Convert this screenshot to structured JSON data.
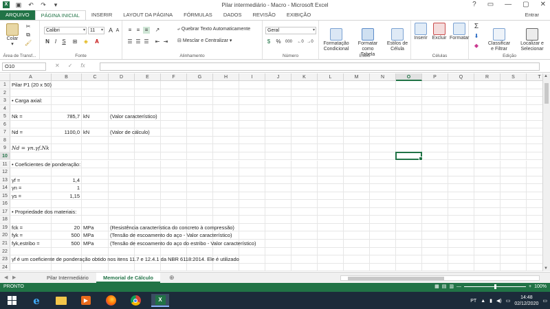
{
  "window": {
    "title": "Pilar intermediário - Macro - Microsoft Excel",
    "controls": [
      "?",
      "▭",
      "—",
      "▢",
      "✕"
    ]
  },
  "ribbon_tabs": [
    "ARQUIVO",
    "PÁGINA INICIAL",
    "INSERIR",
    "LAYOUT DA PÁGINA",
    "FÓRMULAS",
    "DADOS",
    "REVISÃO",
    "EXIBIÇÃO"
  ],
  "user": "Entrar",
  "ribbon": {
    "clipboard": {
      "paste_label": "Colar",
      "group_label": "Área de Transf..."
    },
    "font": {
      "font_name": "Calibri",
      "font_size": "11",
      "group_label": "Fonte",
      "bold": "N",
      "italic": "I",
      "underline": "S"
    },
    "alignment": {
      "wrap_text": "Quebrar Texto Automaticamente",
      "merge_center": "Mesclar e Centralizar",
      "group_label": "Alinhamento"
    },
    "number": {
      "format": "Geral",
      "group_label": "Número",
      "percent": "%",
      "thousands": "000"
    },
    "styles": {
      "conditional": "Formatação\nCondicional",
      "format_table": "Formatar como\nTabela",
      "cell_styles": "Estilos de\nCélula",
      "group_label": "Estilo"
    },
    "cells": {
      "insert": "Inserir",
      "delete": "Excluir",
      "format": "Formatar",
      "group_label": "Células"
    },
    "editing": {
      "sort_filter": "Classificar\ne Filtrar",
      "find_select": "Localizar e\nSelecionar",
      "group_label": "Edição"
    }
  },
  "formula_bar": {
    "name_box": "O10",
    "formula": ""
  },
  "columns": [
    "A",
    "B",
    "C",
    "D",
    "E",
    "F",
    "G",
    "H",
    "I",
    "J",
    "K",
    "L",
    "M",
    "N",
    "O",
    "P",
    "Q",
    "R",
    "S",
    "T"
  ],
  "selected": {
    "column": "O",
    "row": "10"
  },
  "rows": [
    {
      "n": "1",
      "A": "Pilar P1 (20 x 50)"
    },
    {
      "n": "2"
    },
    {
      "n": "3",
      "A": "• Carga axial:"
    },
    {
      "n": "4"
    },
    {
      "n": "5",
      "A": "Nk =",
      "B": "785,7",
      "C": "kN",
      "D": "(Valor característico)"
    },
    {
      "n": "6"
    },
    {
      "n": "7",
      "A": "Nd =",
      "B": "1100,0",
      "C": "kN",
      "D": "(Valor de cálculo)"
    },
    {
      "n": "8"
    },
    {
      "n": "9",
      "A": "Nd = γn.γf.Nk",
      "formula": true
    },
    {
      "n": "10"
    },
    {
      "n": "11",
      "A": "• Coeficientes de ponderação:"
    },
    {
      "n": "12"
    },
    {
      "n": "13",
      "A": "γf =",
      "B": "1,4"
    },
    {
      "n": "14",
      "A": "γn =",
      "B": "1"
    },
    {
      "n": "15",
      "A": "γs =",
      "B": "1,15"
    },
    {
      "n": "16"
    },
    {
      "n": "17",
      "A": "• Propriedade dos materiais:"
    },
    {
      "n": "18"
    },
    {
      "n": "19",
      "A": "fck =",
      "B": "20",
      "C": "MPa",
      "D": "(Resistência característica do concreto à compressão)"
    },
    {
      "n": "20",
      "A": "fyk =",
      "B": "500",
      "C": "MPa",
      "D": "(Tensão de escoamento do aço - Valor característico)"
    },
    {
      "n": "21",
      "A": "fyk,estribo =",
      "B": "500",
      "C": "MPa",
      "D": "(Tensão de escoamento do aço do estribo - Valor característico)"
    },
    {
      "n": "22"
    },
    {
      "n": "23",
      "A": "γf é um coeficiente de ponderação obtido nos itens 11.7 e 12.4.1 da NBR 6118:2014. Ele é utilizado"
    },
    {
      "n": "24"
    }
  ],
  "sheets": [
    "Pilar Intermediário",
    "Memorial de Cálculo"
  ],
  "active_sheet": "Memorial de Cálculo",
  "status": {
    "text": "PRONTO",
    "zoom": "100%",
    "zoom_minus": "—",
    "zoom_plus": "+"
  },
  "taskbar": {
    "apps": [
      "windows-start",
      "internet-explorer",
      "file-explorer",
      "media-player",
      "firefox",
      "chrome",
      "excel"
    ],
    "lang": "PT",
    "time": "14:48",
    "date": "02/12/2020"
  },
  "colors": {
    "excel_green": "#217346",
    "taskbar": "#1c2b3a"
  }
}
